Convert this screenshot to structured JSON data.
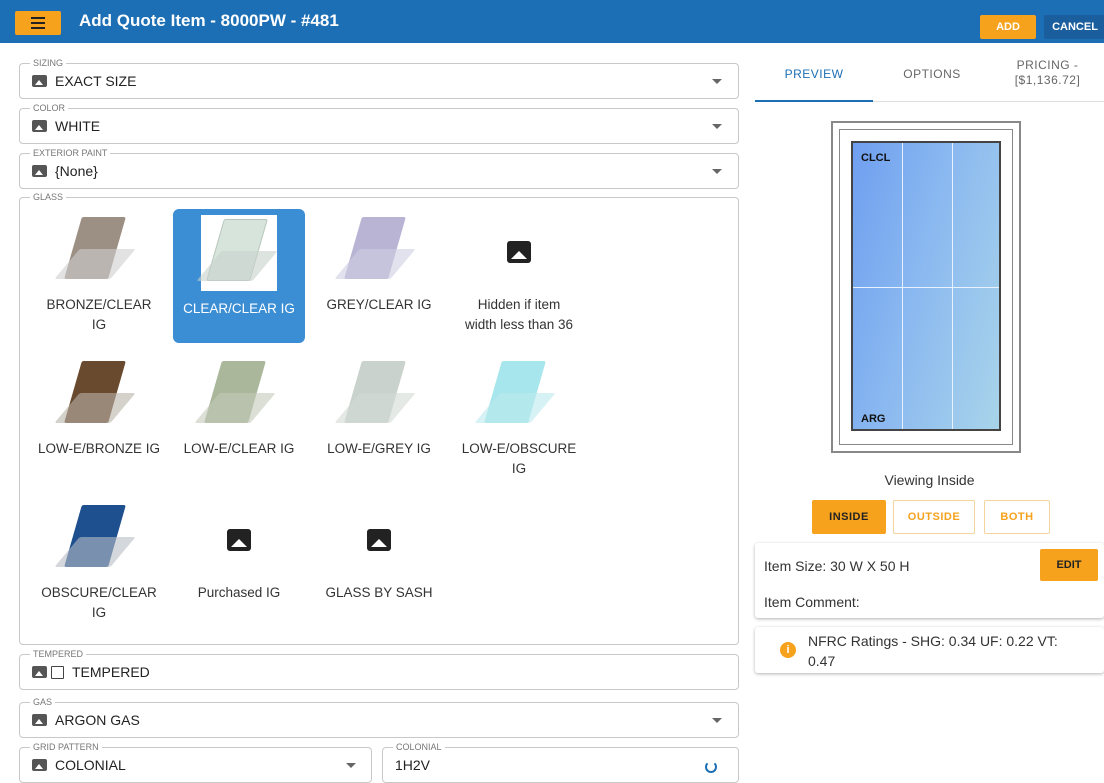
{
  "header": {
    "title": "Add Quote Item - 8000PW - #481",
    "add_label": "ADD",
    "cancel_label": "CANCEL"
  },
  "fields": {
    "sizing": {
      "legend": "SIZING",
      "value": "EXACT SIZE"
    },
    "color": {
      "legend": "COLOR",
      "value": "WHITE"
    },
    "exterior_paint": {
      "legend": "EXTERIOR PAINT",
      "value": "{None}"
    },
    "glass": {
      "legend": "GLASS"
    },
    "tempered": {
      "legend": "TEMPERED",
      "value": "TEMPERED",
      "checked": false
    },
    "gas": {
      "legend": "GAS",
      "value": "ARGON GAS"
    },
    "grid_pattern": {
      "legend": "GRID PATTERN",
      "value": "COLONIAL"
    },
    "colonial": {
      "legend": "COLONIAL",
      "value": "1H2V"
    }
  },
  "glass_options": [
    {
      "label1": "BRONZE/CLEAR",
      "label2": "IG",
      "selected": false,
      "color": "#9c8f84"
    },
    {
      "label1": "CLEAR/CLEAR IG",
      "label2": "",
      "selected": true,
      "color": "#d7e4dc"
    },
    {
      "label1": "GREY/CLEAR IG",
      "label2": "",
      "selected": false,
      "color": "#b9b4d4"
    },
    {
      "label1": "Hidden if item",
      "label2": "width less than 36",
      "selected": false,
      "placeholder": true
    },
    {
      "label1": "LOW-E/BRONZE IG",
      "label2": "",
      "selected": false,
      "color": "#6a4a2e"
    },
    {
      "label1": "LOW-E/CLEAR IG",
      "label2": "",
      "selected": false,
      "color": "#aab79a"
    },
    {
      "label1": "LOW-E/GREY IG",
      "label2": "",
      "selected": false,
      "color": "#c9d2cc"
    },
    {
      "label1": "LOW-E/OBSCURE",
      "label2": "IG",
      "selected": false,
      "color": "#a6e6ec"
    },
    {
      "label1": "OBSCURE/CLEAR",
      "label2": "IG",
      "selected": false,
      "color": "#1e4f8f"
    },
    {
      "label1": "Purchased IG",
      "label2": "",
      "selected": false,
      "placeholder": true
    },
    {
      "label1": "GLASS BY SASH",
      "label2": "",
      "selected": false,
      "placeholder": true
    }
  ],
  "right_panel": {
    "tabs": {
      "preview": "PREVIEW",
      "options": "OPTIONS",
      "pricing1": "PRICING -",
      "pricing2": "[$1,136.72]"
    },
    "preview": {
      "top_label": "CLCL",
      "bottom_label": "ARG",
      "viewing": "Viewing Inside"
    },
    "view_buttons": {
      "inside": "INSIDE",
      "outside": "OUTSIDE",
      "both": "BOTH"
    },
    "item_size": "Item Size:  30 W X 50 H",
    "edit_label": "EDIT",
    "item_comment": "Item Comment:",
    "nfrc1": "NFRC Ratings - SHG: 0.34 UF: 0.22 VT:",
    "nfrc2": "0.47"
  },
  "colors": {
    "accent": "#f6a21d",
    "primary": "#1d6fb5",
    "selected": "#3b8ed4"
  }
}
